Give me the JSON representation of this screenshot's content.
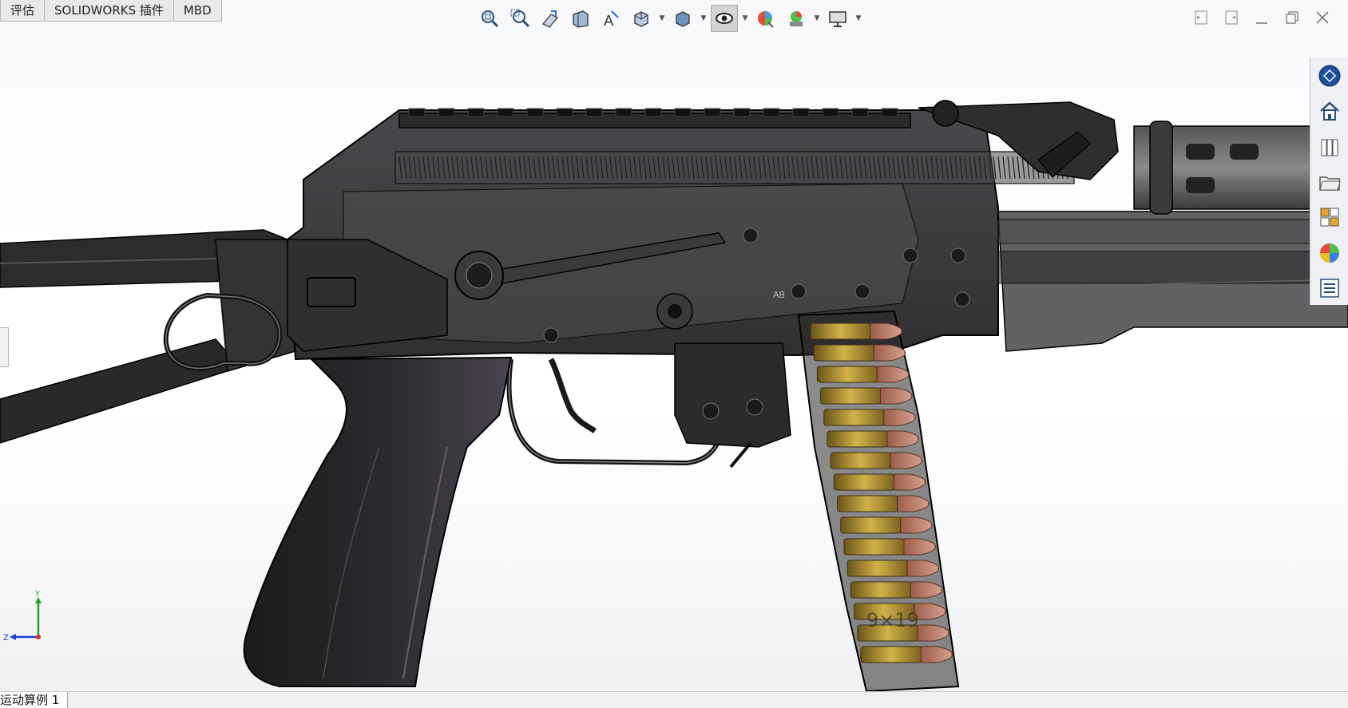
{
  "command_tabs": [
    "评估",
    "SOLIDWORKS 插件",
    "MBD"
  ],
  "hud_icons": [
    "zoom-to-fit-icon",
    "zoom-to-area-icon",
    "previous-view-icon",
    "section-view-icon",
    "dynamic-annotation-icon",
    "view-orientation-icon",
    "display-style-icon",
    "hide-show-items-icon",
    "edit-appearance-icon",
    "apply-scene-icon",
    "view-settings-icon"
  ],
  "task_pane_icons": [
    "solidworks-resources-icon",
    "home-icon",
    "design-library-icon",
    "file-explorer-icon",
    "view-palette-icon",
    "appearances-icon",
    "custom-properties-icon"
  ],
  "window_controls": [
    "tile-left-icon",
    "tile-right-icon",
    "minimize-icon",
    "restore-icon",
    "close-icon"
  ],
  "triad": {
    "y": "Y",
    "z": "Z"
  },
  "model_labels": {
    "caliber": "9×19",
    "selector_mark": "AB"
  },
  "status_bar": {
    "motion_study_tab": "运动算例 1"
  },
  "colors": {
    "body": "#2a2a2c",
    "cartridge_brass": "#c9a63a",
    "bullet_copper": "#b7715a",
    "accent_blue": "#1f6fd1"
  }
}
